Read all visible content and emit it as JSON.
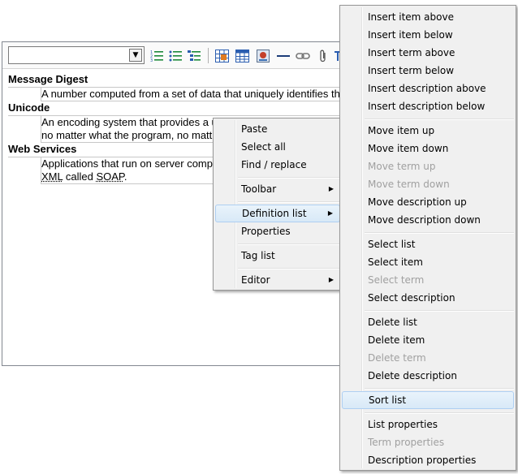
{
  "toolbar": {
    "format_select_value": "",
    "format_select_arrow": "▼",
    "icons": [
      "numbered-list-icon",
      "bullet-list-icon",
      "outline-list-icon",
      "image-icon",
      "table-icon",
      "media-icon",
      "horizontal-rule-icon",
      "link-icon",
      "attachment-icon",
      "more-icon"
    ]
  },
  "definitions": [
    {
      "term": "Message Digest",
      "desc": [
        "A number computed from a set of data that uniquely identifies th"
      ]
    },
    {
      "term": "Unicode",
      "desc": [
        "An encoding system that provides a u",
        "no matter what the program, no matt"
      ]
    },
    {
      "term": "Web Services",
      "desc_line1": "Applications that run on server comp",
      "desc_line2_abbr": "XML",
      "desc_line2_mid": " called ",
      "desc_line2_abbr2": "SOAP",
      "desc_line2_end": "."
    }
  ],
  "context_menu": {
    "items": [
      {
        "label": "Paste"
      },
      {
        "label": "Select all"
      },
      {
        "label": "Find / replace"
      },
      {
        "label": "Toolbar",
        "submenu": true
      },
      {
        "label": "Definition list",
        "submenu": true
      },
      {
        "label": "Properties"
      },
      {
        "label": "Tag list"
      },
      {
        "label": "Editor",
        "submenu": true
      }
    ],
    "submenu_arrow": "▶"
  },
  "submenu": {
    "items": [
      {
        "label": "Insert item above"
      },
      {
        "label": "Insert item below"
      },
      {
        "label": "Insert term above"
      },
      {
        "label": "Insert term below"
      },
      {
        "label": "Insert description above"
      },
      {
        "label": "Insert description below"
      },
      {
        "label": "Move item up"
      },
      {
        "label": "Move item down"
      },
      {
        "label": "Move term up"
      },
      {
        "label": "Move term down"
      },
      {
        "label": "Move description up"
      },
      {
        "label": "Move description down"
      },
      {
        "label": "Select list"
      },
      {
        "label": "Select item"
      },
      {
        "label": "Select term"
      },
      {
        "label": "Select description"
      },
      {
        "label": "Delete list"
      },
      {
        "label": "Delete item"
      },
      {
        "label": "Delete term"
      },
      {
        "label": "Delete description"
      },
      {
        "label": "Sort list"
      },
      {
        "label": "List properties"
      },
      {
        "label": "Term properties"
      },
      {
        "label": "Description properties"
      }
    ]
  },
  "colors": {
    "highlight": "#d8e9f7",
    "disabled_text": "#a0a0a0",
    "menu_bg": "#f0f0f0"
  }
}
